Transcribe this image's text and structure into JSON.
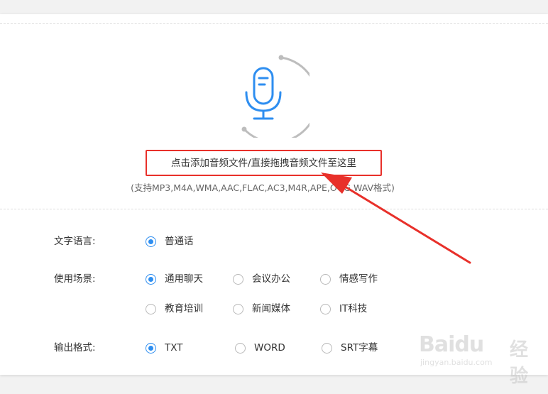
{
  "upload": {
    "title": "点击添加音频文件/直接拖拽音频文件至这里",
    "formats": "(支持MP3,M4A,WMA,AAC,FLAC,AC3,M4R,APE,OGG,WAV格式)",
    "icon": "microphone-icon"
  },
  "settings": {
    "language": {
      "label": "文字语言:",
      "options": [
        {
          "label": "普通话",
          "checked": true
        }
      ]
    },
    "scene": {
      "label": "使用场景:",
      "options": [
        {
          "label": "通用聊天",
          "checked": true
        },
        {
          "label": "会议办公",
          "checked": false
        },
        {
          "label": "情感写作",
          "checked": false
        },
        {
          "label": "教育培训",
          "checked": false
        },
        {
          "label": "新闻媒体",
          "checked": false
        },
        {
          "label": "IT科技",
          "checked": false
        }
      ]
    },
    "output": {
      "label": "输出格式:",
      "options": [
        {
          "label": "TXT",
          "checked": true
        },
        {
          "label": "WORD",
          "checked": false
        },
        {
          "label": "SRT字幕",
          "checked": false
        }
      ]
    }
  },
  "watermark": {
    "brand": "Baidu",
    "suffix": "经验",
    "url": "jingyan.baidu.com"
  },
  "colors": {
    "accent": "#2e8ef0",
    "annotation_red": "#e8302a"
  }
}
